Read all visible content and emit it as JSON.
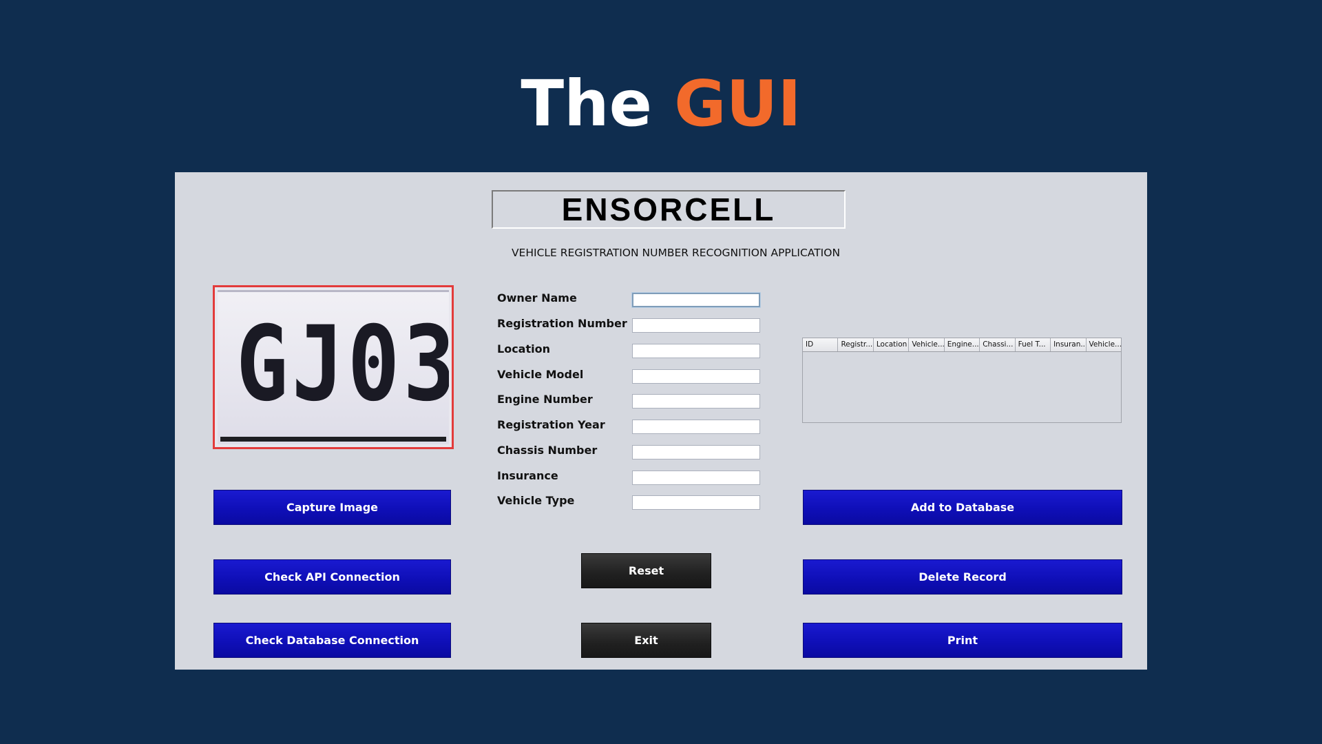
{
  "slide": {
    "title_prefix": "The",
    "title_accent": "GUI"
  },
  "app": {
    "brand": "ENSORCELL",
    "subtitle": "VEHICLE REGISTRATION NUMBER RECOGNITION APPLICATION",
    "plate_text": "GJ03"
  },
  "form": {
    "fields": [
      {
        "label": "Owner Name",
        "value": ""
      },
      {
        "label": "Registration Number",
        "value": ""
      },
      {
        "label": "Location",
        "value": ""
      },
      {
        "label": "Vehicle Model",
        "value": ""
      },
      {
        "label": "Engine Number",
        "value": ""
      },
      {
        "label": "Registration Year",
        "value": ""
      },
      {
        "label": "Chassis Number",
        "value": ""
      },
      {
        "label": "Insurance",
        "value": ""
      },
      {
        "label": "Vehicle Type",
        "value": ""
      }
    ]
  },
  "table": {
    "columns": [
      "ID",
      "Registr...",
      "Location",
      "Vehicle...",
      "Engine...",
      "Chassi...",
      "Fuel T...",
      "Insuran...",
      "Vehicle..."
    ],
    "rows": []
  },
  "buttons": {
    "capture": "Capture Image",
    "check_api": "Check API Connection",
    "check_db": "Check Database Connection",
    "reset": "Reset",
    "exit": "Exit",
    "add": "Add to Database",
    "delete": "Delete Record",
    "print": "Print"
  },
  "colors": {
    "background": "#0f2d4f",
    "accent": "#f26a2b",
    "button_blue": "#1010c0",
    "button_dark": "#222222",
    "plate_border": "#e33b3b"
  }
}
